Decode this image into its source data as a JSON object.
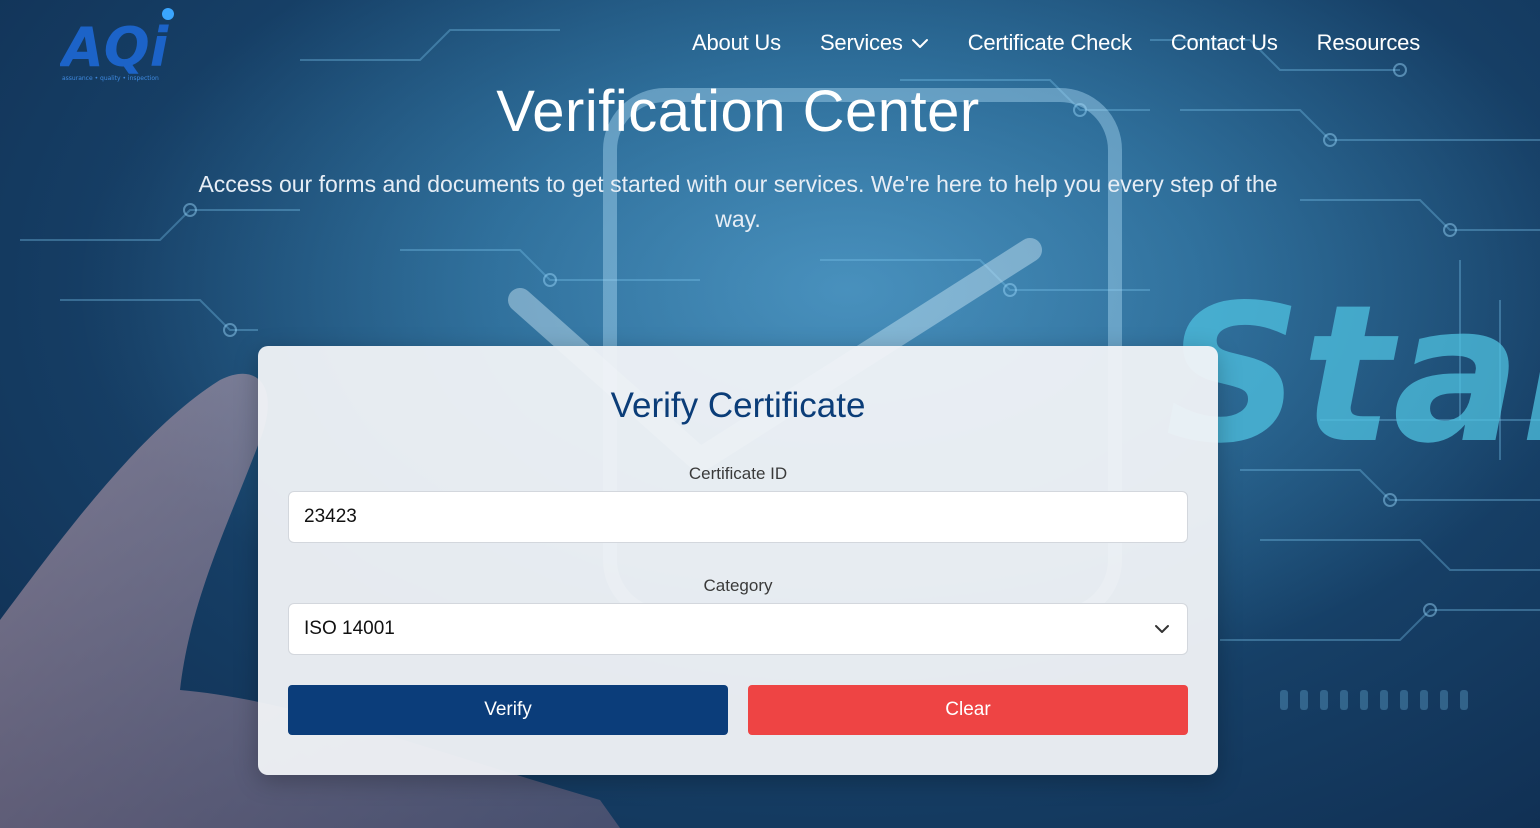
{
  "header": {
    "logo_text": "AQi",
    "logo_tagline": "assurance • quality • inspection",
    "nav": [
      {
        "label": "About Us"
      },
      {
        "label": "Services"
      },
      {
        "label": "Certificate Check"
      },
      {
        "label": "Contact Us"
      },
      {
        "label": "Resources"
      }
    ]
  },
  "hero": {
    "title": "Verification Center",
    "subtitle": "Access our forms and documents to get started with our services. We're here to help you every step of the way.",
    "background_word": "Stand"
  },
  "form": {
    "title": "Verify Certificate",
    "certificate_id_label": "Certificate ID",
    "certificate_id_value": "23423",
    "category_label": "Category",
    "category_value": "ISO 14001",
    "verify_label": "Verify",
    "clear_label": "Clear"
  },
  "colors": {
    "brand_blue": "#0b3d7a",
    "clear_red": "#ee4444",
    "title_blue": "#0b3d78"
  },
  "icons": {
    "services_dropdown": "chevron-down-icon",
    "category_dropdown": "chevron-down-icon"
  }
}
